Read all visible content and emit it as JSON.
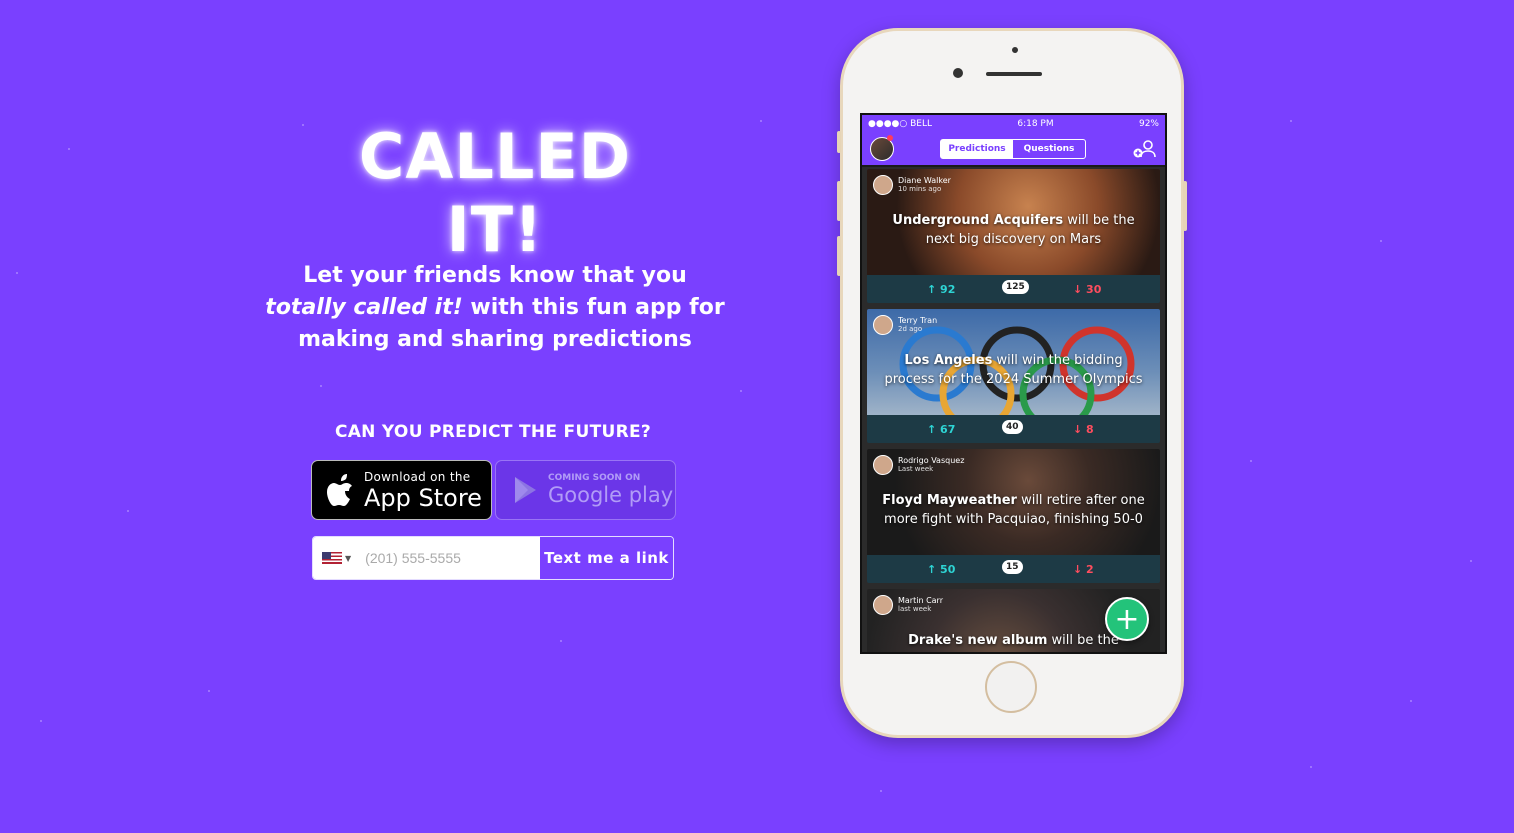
{
  "logo": "CALLED IT!",
  "tagline": {
    "part1": "Let your friends know that you ",
    "emphasis": "totally called it!",
    "part2": " with this fun app for making and sharing predictions"
  },
  "cta_heading": "CAN YOU PREDICT THE FUTURE?",
  "app_store": {
    "small": "Download on the",
    "big": "App Store"
  },
  "google_play": {
    "small": "COMING SOON ON",
    "big": "Google play"
  },
  "sms": {
    "placeholder": "(201) 555-5555",
    "button": "Text me a link",
    "flag": "us-flag-icon"
  },
  "phone": {
    "status": {
      "carrier": "●●●●○ BELL",
      "time": "6:18 PM",
      "battery": "92%"
    },
    "tabs": [
      "Predictions",
      "Questions"
    ],
    "feed": [
      {
        "user": "Diane Walker",
        "time": "10 mins ago",
        "bold": "Underground Acquifers",
        "text": " will be the next big discovery on Mars",
        "up": "92",
        "comments": "125",
        "down": "30",
        "bg": "#8a4a2a"
      },
      {
        "user": "Terry Tran",
        "time": "2d ago",
        "bold": "Los Angeles",
        "text": " will win the bidding process for the 2024 Summer Olympics",
        "up": "67",
        "comments": "40",
        "down": "8",
        "bg": "#4a6a9a"
      },
      {
        "user": "Rodrigo Vasquez",
        "time": "Last week",
        "bold": "Floyd Mayweather",
        "text": " will retire after one more fight with Pacquiao, finishing 50-0",
        "up": "50",
        "comments": "15",
        "down": "2",
        "bg": "#3a3a3a"
      },
      {
        "user": "Martin Carr",
        "time": "last week",
        "bold": "Drake's new album",
        "text": " will be the",
        "up": "",
        "comments": "",
        "down": "",
        "bg": "#555"
      }
    ],
    "fab": "+"
  }
}
